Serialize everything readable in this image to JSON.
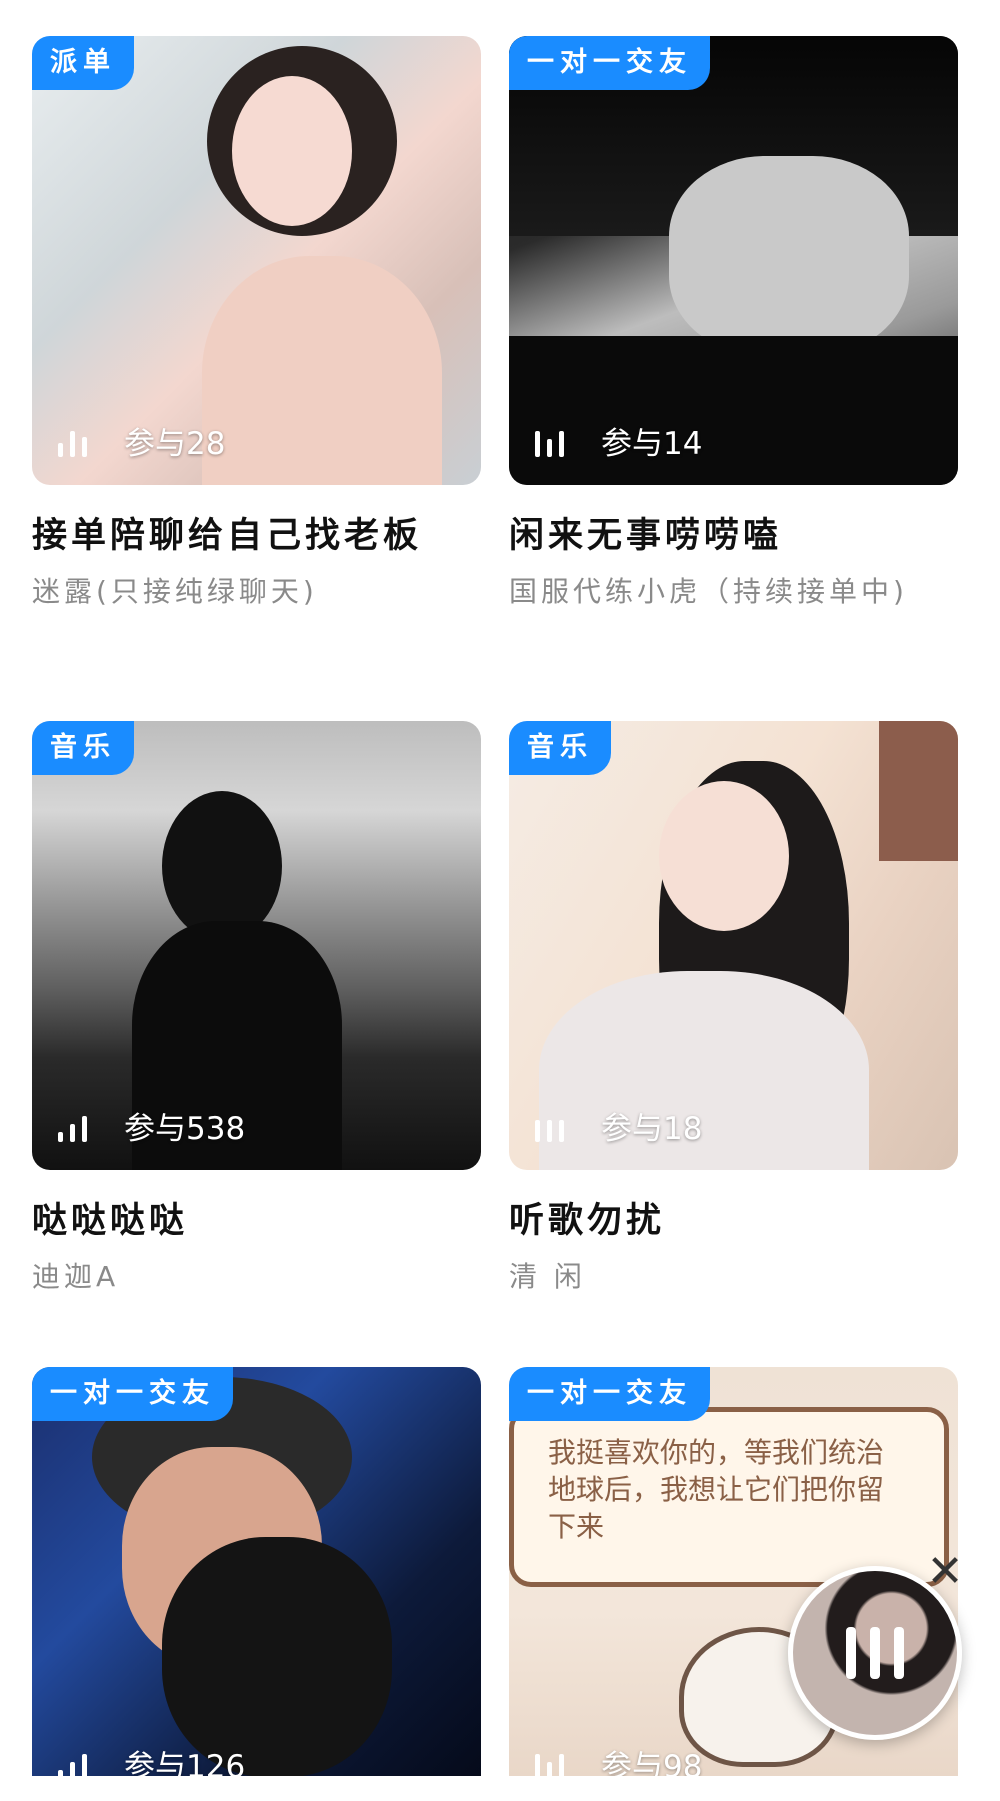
{
  "cards": [
    {
      "tag": "派单",
      "participants": "参与28",
      "title": "接单陪聊给自己找老板",
      "subtitle": "迷露(只接纯绿聊天)"
    },
    {
      "tag": "一对一交友",
      "participants": "参与14",
      "title": "闲来无事唠唠嗑",
      "subtitle": "国服代练小虎（持续接单中)"
    },
    {
      "tag": "音乐",
      "participants": "参与538",
      "title": "哒哒哒哒",
      "subtitle": "迪迦A"
    },
    {
      "tag": "音乐",
      "participants": "参与18",
      "title": "听歌勿扰",
      "subtitle": "清 闲"
    },
    {
      "tag": "一对一交友",
      "participants": "参与126",
      "title": "",
      "subtitle": ""
    },
    {
      "tag": "一对一交友",
      "participants": "参与98",
      "title": "",
      "subtitle": "",
      "bubble_text": "我挺喜欢你的，等我们统治地球后，我想让它们把你留下来"
    }
  ],
  "floating_player": {
    "icon": "pause-icon",
    "close_icon": "close-icon"
  },
  "colors": {
    "tag_bg": "#1a8cff",
    "subtitle": "#8a8a8a",
    "title": "#111111"
  }
}
